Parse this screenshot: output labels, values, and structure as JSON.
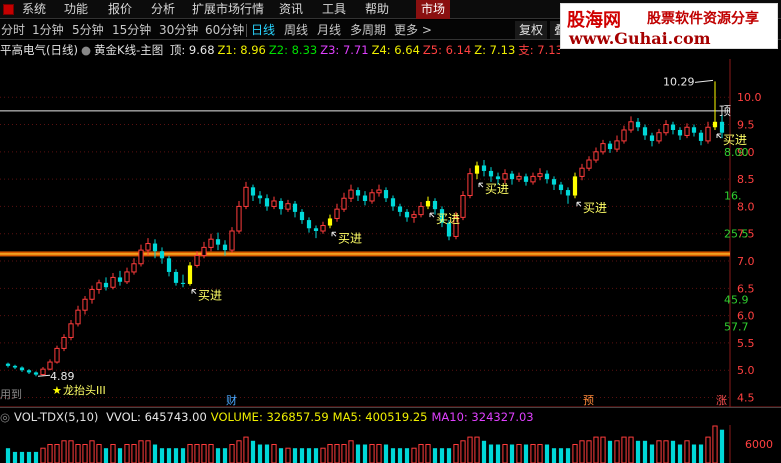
{
  "menu": {
    "items": [
      "系统",
      "功能",
      "报价",
      "分析",
      "扩展市场行情",
      "资讯",
      "工具",
      "帮助"
    ],
    "market_tab": "市场"
  },
  "periods": {
    "items": [
      "分时",
      "1分钟",
      "5分钟",
      "15分钟",
      "30分钟",
      "60分钟",
      "日线",
      "周线",
      "月线",
      "多周期",
      "更多 >"
    ],
    "active_index": 6
  },
  "toolbar": {
    "fuquan": "复权",
    "extra": "叠"
  },
  "watermark": {
    "title": "股海网",
    "subtitle": "股票软件资源分享",
    "url": "www.Guhai.com"
  },
  "main_info": {
    "stock": "平高电气(日线)",
    "indicator": "黄金K线-主图",
    "values": [
      {
        "label": "顶:",
        "value": "9.68",
        "color": "#e8e8e8"
      },
      {
        "label": "Z1:",
        "value": "8.96",
        "color": "#f0f000"
      },
      {
        "label": "Z2:",
        "value": "8.33",
        "color": "#00e000"
      },
      {
        "label": "Z3:",
        "value": "7.71",
        "color": "#e040ff"
      },
      {
        "label": "Z4:",
        "value": "6.64",
        "color": "#f0f000"
      },
      {
        "label": "Z5:",
        "value": "6.14",
        "color": "#ff4040"
      },
      {
        "label": "Z:",
        "value": "7.13",
        "color": "#f0f000"
      },
      {
        "label": "支:",
        "value": "7.13",
        "color": "#ff4040"
      }
    ]
  },
  "volume_info": {
    "indicator": "VOL-TDX(5,10)",
    "values": [
      {
        "label": "VVOL:",
        "value": "645743.00",
        "color": "#e8e8e8"
      },
      {
        "label": "VOLUME:",
        "value": "326857.59",
        "color": "#f0f000"
      },
      {
        "label": "MA5:",
        "value": "400519.25",
        "color": "#f0f000"
      },
      {
        "label": "MA10:",
        "value": "324327.03",
        "color": "#e040ff"
      }
    ],
    "axis_label": "6000"
  },
  "chart_data": {
    "type": "candlestick",
    "ylim": [
      4.4,
      10.7
    ],
    "yticks": [
      "10.0",
      "9.5",
      "9.0",
      "8.5",
      "8.0",
      "7.5",
      "7.0",
      "6.5",
      "6.0",
      "5.5",
      "5.0",
      "4.5"
    ],
    "level_labels": [
      "8.00",
      "16.",
      "25.5",
      "45.9",
      "57.7"
    ],
    "level_values": [
      9.0,
      8.2,
      7.5,
      6.3,
      5.8
    ],
    "resistance_top": 9.75,
    "support_line": 7.13,
    "peak_label": "10.29",
    "peak_value": 10.29,
    "low_label": "4.89",
    "low_value": 4.89,
    "bottom_signal": "龙抬头III",
    "bottom_prefix": "用到",
    "top_signal": "顶",
    "buy_signals": [
      {
        "label": "买进",
        "index": 26
      },
      {
        "label": "买进",
        "index": 46
      },
      {
        "label": "买进",
        "index": 60
      },
      {
        "label": "买进",
        "index": 67
      },
      {
        "label": "买进",
        "index": 81
      },
      {
        "label": "买进",
        "index": 101
      }
    ],
    "date_markers": [
      {
        "label": "财",
        "index": 32,
        "color": "#4aa8ff"
      },
      {
        "label": "预",
        "index": 83,
        "color": "#ff8a3a"
      },
      {
        "label": "涨",
        "index": 102,
        "color": "#ff5050"
      }
    ],
    "candles": [
      [
        5.12,
        5.08,
        5.14,
        5.05
      ],
      [
        5.08,
        5.05,
        5.1,
        5.02
      ],
      [
        5.05,
        5.0,
        5.07,
        4.97
      ],
      [
        5.0,
        4.96,
        5.02,
        4.93
      ],
      [
        4.96,
        4.92,
        4.98,
        4.89
      ],
      [
        4.92,
        5.02,
        5.06,
        4.9
      ],
      [
        5.02,
        5.15,
        5.2,
        5.0
      ],
      [
        5.15,
        5.4,
        5.45,
        5.12
      ],
      [
        5.4,
        5.6,
        5.66,
        5.35
      ],
      [
        5.6,
        5.85,
        5.92,
        5.55
      ],
      [
        5.85,
        6.1,
        6.18,
        5.8
      ],
      [
        6.1,
        6.3,
        6.36,
        6.02
      ],
      [
        6.3,
        6.48,
        6.55,
        6.22
      ],
      [
        6.48,
        6.6,
        6.66,
        6.4
      ],
      [
        6.6,
        6.52,
        6.7,
        6.46
      ],
      [
        6.52,
        6.7,
        6.78,
        6.48
      ],
      [
        6.7,
        6.62,
        6.82,
        6.55
      ],
      [
        6.62,
        6.8,
        6.88,
        6.58
      ],
      [
        6.8,
        6.95,
        7.05,
        6.75
      ],
      [
        6.95,
        7.2,
        7.3,
        6.9
      ],
      [
        7.2,
        7.32,
        7.42,
        7.1
      ],
      [
        7.32,
        7.18,
        7.4,
        7.05
      ],
      [
        7.18,
        7.05,
        7.25,
        6.95
      ],
      [
        7.05,
        6.8,
        7.1,
        6.72
      ],
      [
        6.8,
        6.6,
        6.85,
        6.55
      ],
      [
        6.6,
        6.58,
        6.75,
        6.52
      ],
      [
        6.58,
        6.92,
        6.98,
        6.55
      ],
      [
        6.92,
        7.1,
        7.18,
        6.88
      ],
      [
        7.1,
        7.25,
        7.35,
        7.05
      ],
      [
        7.25,
        7.4,
        7.5,
        7.18
      ],
      [
        7.4,
        7.3,
        7.52,
        7.2
      ],
      [
        7.3,
        7.2,
        7.38,
        7.1
      ],
      [
        7.2,
        7.55,
        7.62,
        7.15
      ],
      [
        7.55,
        8.0,
        8.1,
        7.5
      ],
      [
        8.0,
        8.35,
        8.45,
        7.95
      ],
      [
        8.35,
        8.2,
        8.4,
        8.1
      ],
      [
        8.2,
        8.15,
        8.28,
        8.05
      ],
      [
        8.15,
        8.0,
        8.22,
        7.92
      ],
      [
        8.0,
        8.1,
        8.18,
        7.95
      ],
      [
        8.1,
        7.95,
        8.15,
        7.85
      ],
      [
        7.95,
        8.05,
        8.12,
        7.9
      ],
      [
        8.05,
        7.9,
        8.1,
        7.8
      ],
      [
        7.9,
        7.75,
        7.95,
        7.68
      ],
      [
        7.75,
        7.6,
        7.8,
        7.52
      ],
      [
        7.6,
        7.55,
        7.65,
        7.42
      ],
      [
        7.55,
        7.65,
        7.72,
        7.5
      ],
      [
        7.65,
        7.78,
        7.85,
        7.6
      ],
      [
        7.78,
        7.95,
        8.05,
        7.72
      ],
      [
        7.95,
        8.15,
        8.25,
        7.9
      ],
      [
        8.15,
        8.3,
        8.4,
        8.08
      ],
      [
        8.3,
        8.2,
        8.35,
        8.1
      ],
      [
        8.2,
        8.1,
        8.28,
        8.02
      ],
      [
        8.1,
        8.25,
        8.32,
        8.05
      ],
      [
        8.25,
        8.3,
        8.4,
        8.18
      ],
      [
        8.3,
        8.15,
        8.35,
        8.08
      ],
      [
        8.15,
        8.0,
        8.2,
        7.92
      ],
      [
        8.0,
        7.9,
        8.05,
        7.82
      ],
      [
        7.9,
        7.8,
        7.95,
        7.72
      ],
      [
        7.8,
        7.85,
        7.92,
        7.7
      ],
      [
        7.85,
        8.0,
        8.08,
        7.8
      ],
      [
        8.0,
        8.1,
        8.18,
        7.95
      ],
      [
        8.1,
        7.95,
        8.15,
        7.85
      ],
      [
        7.95,
        7.7,
        8.0,
        7.62
      ],
      [
        7.7,
        7.45,
        7.75,
        7.38
      ],
      [
        7.45,
        7.8,
        7.9,
        7.4
      ],
      [
        7.8,
        8.2,
        8.28,
        7.75
      ],
      [
        8.2,
        8.6,
        8.7,
        8.15
      ],
      [
        8.6,
        8.75,
        8.82,
        8.5
      ],
      [
        8.75,
        8.65,
        8.85,
        8.55
      ],
      [
        8.65,
        8.55,
        8.72,
        8.45
      ],
      [
        8.55,
        8.5,
        8.62,
        8.4
      ],
      [
        8.5,
        8.6,
        8.68,
        8.42
      ],
      [
        8.6,
        8.5,
        8.65,
        8.4
      ],
      [
        8.5,
        8.55,
        8.62,
        8.45
      ],
      [
        8.55,
        8.45,
        8.6,
        8.38
      ],
      [
        8.45,
        8.55,
        8.62,
        8.4
      ],
      [
        8.55,
        8.6,
        8.7,
        8.48
      ],
      [
        8.6,
        8.5,
        8.66,
        8.42
      ],
      [
        8.5,
        8.4,
        8.55,
        8.3
      ],
      [
        8.4,
        8.3,
        8.45,
        8.22
      ],
      [
        8.3,
        8.2,
        8.35,
        8.05
      ],
      [
        8.2,
        8.55,
        8.62,
        8.15
      ],
      [
        8.55,
        8.7,
        8.78,
        8.48
      ],
      [
        8.7,
        8.85,
        8.92,
        8.65
      ],
      [
        8.85,
        9.0,
        9.08,
        8.8
      ],
      [
        9.0,
        9.15,
        9.22,
        8.95
      ],
      [
        9.15,
        9.05,
        9.2,
        8.98
      ],
      [
        9.05,
        9.2,
        9.3,
        9.0
      ],
      [
        9.2,
        9.4,
        9.48,
        9.15
      ],
      [
        9.4,
        9.55,
        9.65,
        9.35
      ],
      [
        9.55,
        9.45,
        9.62,
        9.38
      ],
      [
        9.45,
        9.3,
        9.5,
        9.22
      ],
      [
        9.3,
        9.2,
        9.35,
        9.1
      ],
      [
        9.2,
        9.35,
        9.42,
        9.15
      ],
      [
        9.35,
        9.5,
        9.58,
        9.3
      ],
      [
        9.5,
        9.4,
        9.55,
        9.32
      ],
      [
        9.4,
        9.3,
        9.45,
        9.22
      ],
      [
        9.3,
        9.45,
        9.52,
        9.25
      ],
      [
        9.45,
        9.35,
        9.5,
        9.28
      ],
      [
        9.35,
        9.2,
        9.4,
        9.12
      ],
      [
        9.2,
        9.45,
        9.55,
        9.15
      ],
      [
        9.45,
        9.55,
        10.29,
        9.4
      ],
      [
        9.55,
        9.35,
        9.7,
        9.25
      ]
    ],
    "volumes": [
      4,
      3,
      3,
      3,
      3,
      4,
      5,
      5,
      6,
      6,
      5,
      5,
      6,
      5,
      4,
      5,
      4,
      5,
      5,
      6,
      6,
      5,
      4,
      4,
      4,
      4,
      5,
      5,
      5,
      5,
      4,
      4,
      5,
      6,
      7,
      6,
      5,
      5,
      5,
      4,
      4,
      4,
      4,
      4,
      4,
      4,
      5,
      5,
      5,
      6,
      5,
      5,
      5,
      5,
      5,
      4,
      4,
      4,
      4,
      5,
      5,
      4,
      4,
      4,
      5,
      6,
      7,
      7,
      6,
      5,
      5,
      5,
      5,
      5,
      5,
      5,
      5,
      5,
      4,
      4,
      4,
      5,
      6,
      6,
      7,
      7,
      6,
      6,
      7,
      7,
      6,
      6,
      5,
      6,
      6,
      6,
      5,
      6,
      5,
      5,
      7,
      10,
      9
    ]
  }
}
